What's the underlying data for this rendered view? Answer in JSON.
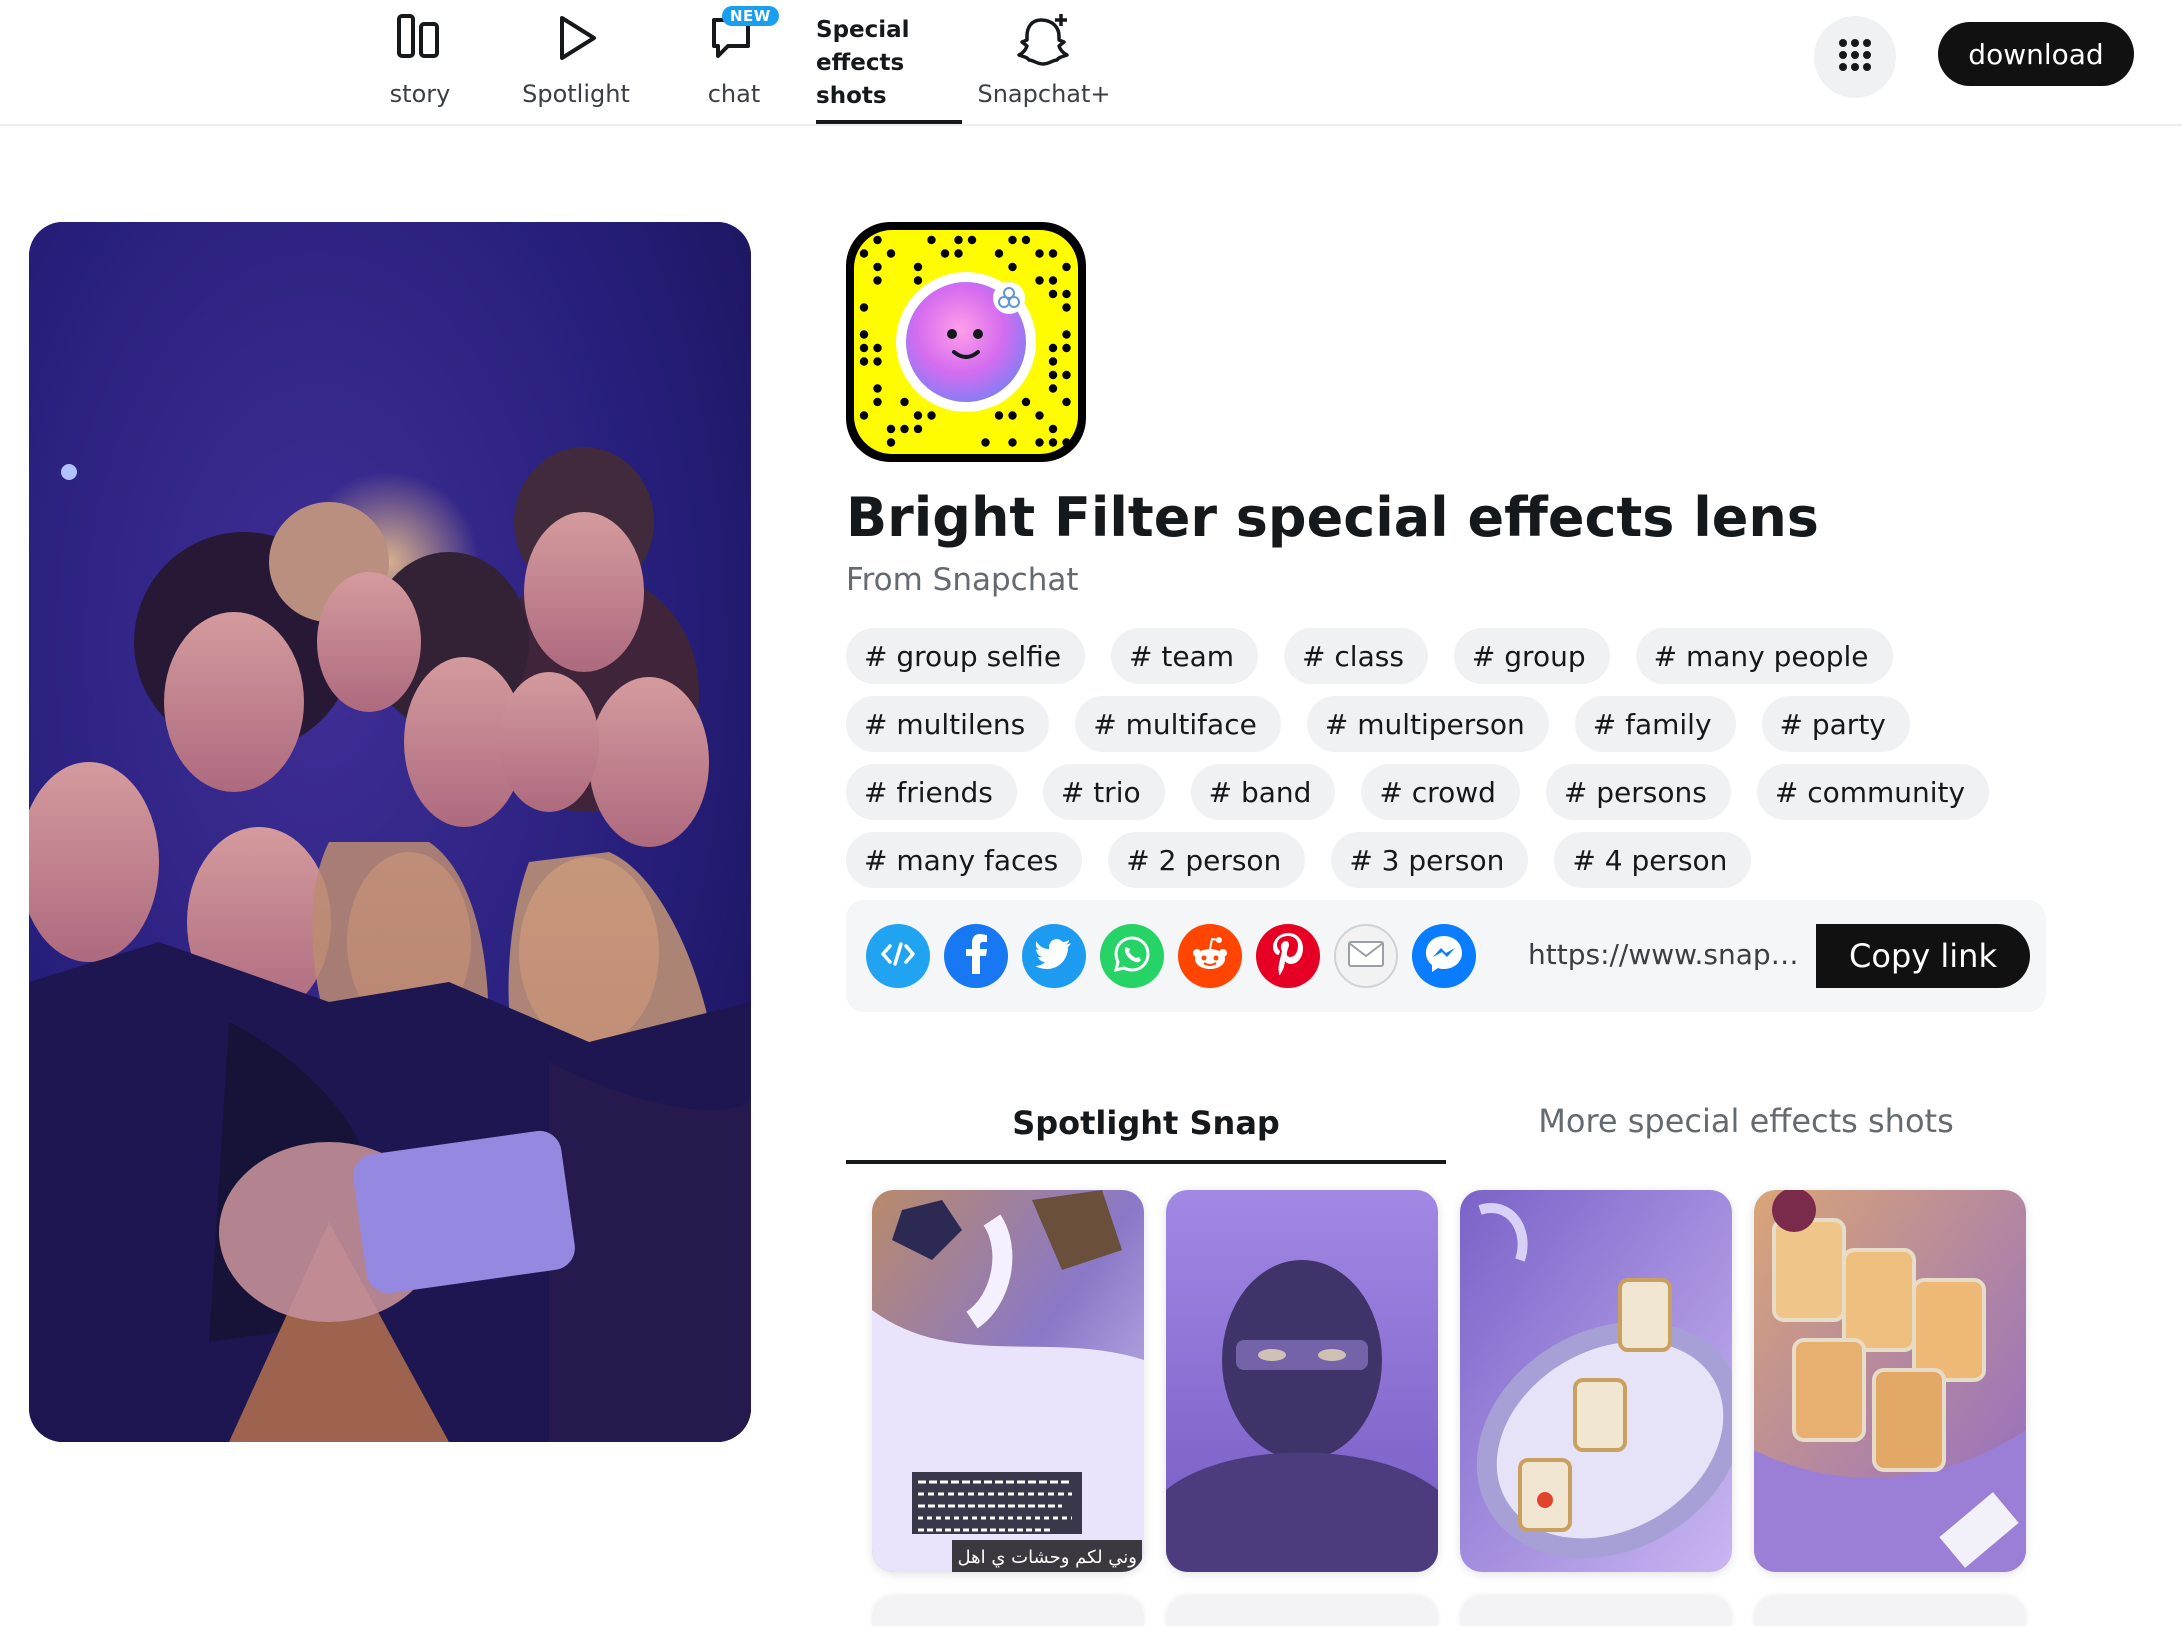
{
  "nav": {
    "items": [
      {
        "label": "story",
        "icon": "story-icon"
      },
      {
        "label": "Spotlight",
        "icon": "play-icon"
      },
      {
        "label": "chat",
        "icon": "chat-icon",
        "badge": "NEW"
      }
    ],
    "special": {
      "line1": "Special",
      "line2": "effects",
      "line3": "shots"
    },
    "snapchat_plus": {
      "label": "Snapchat+",
      "icon": "ghost-plus-icon"
    },
    "apps_icon": "grid-dots-icon",
    "download_label": "download"
  },
  "lens": {
    "title": "Bright Filter special effects lens",
    "subtitle": "From Snapchat",
    "tags": [
      "# group selfie",
      "# team",
      "# class",
      "# group",
      "# many people",
      "# multilens",
      "# multiface",
      "# multiperson",
      "# family",
      "# party",
      "# friends",
      "# trio",
      "# band",
      "# crowd",
      "# persons",
      "# community",
      "# many faces",
      "# 2 person",
      "# 3 person",
      "# 4 person"
    ]
  },
  "share": {
    "icons": [
      "embed-icon",
      "facebook-icon",
      "twitter-icon",
      "whatsapp-icon",
      "reddit-icon",
      "pinterest-icon",
      "email-icon",
      "messenger-icon"
    ],
    "url": "https://www.snapc...",
    "copy_label": "Copy link"
  },
  "tabs": {
    "active": "Spotlight Snap",
    "inactive": "More special effects shots"
  },
  "thumbs": {
    "overlay_arabic": "وني لكم وحشات ي اهل"
  },
  "colors": {
    "brand_yellow": "#fffc00",
    "dark": "#16191c",
    "tag_bg": "#f0f1f3",
    "facebook": "#1877f2",
    "twitter": "#1d9bf0",
    "whatsapp": "#25d366",
    "reddit": "#ff4500",
    "pinterest": "#e60023",
    "messenger": "#0a7cff",
    "embed": "#20a3f0"
  }
}
